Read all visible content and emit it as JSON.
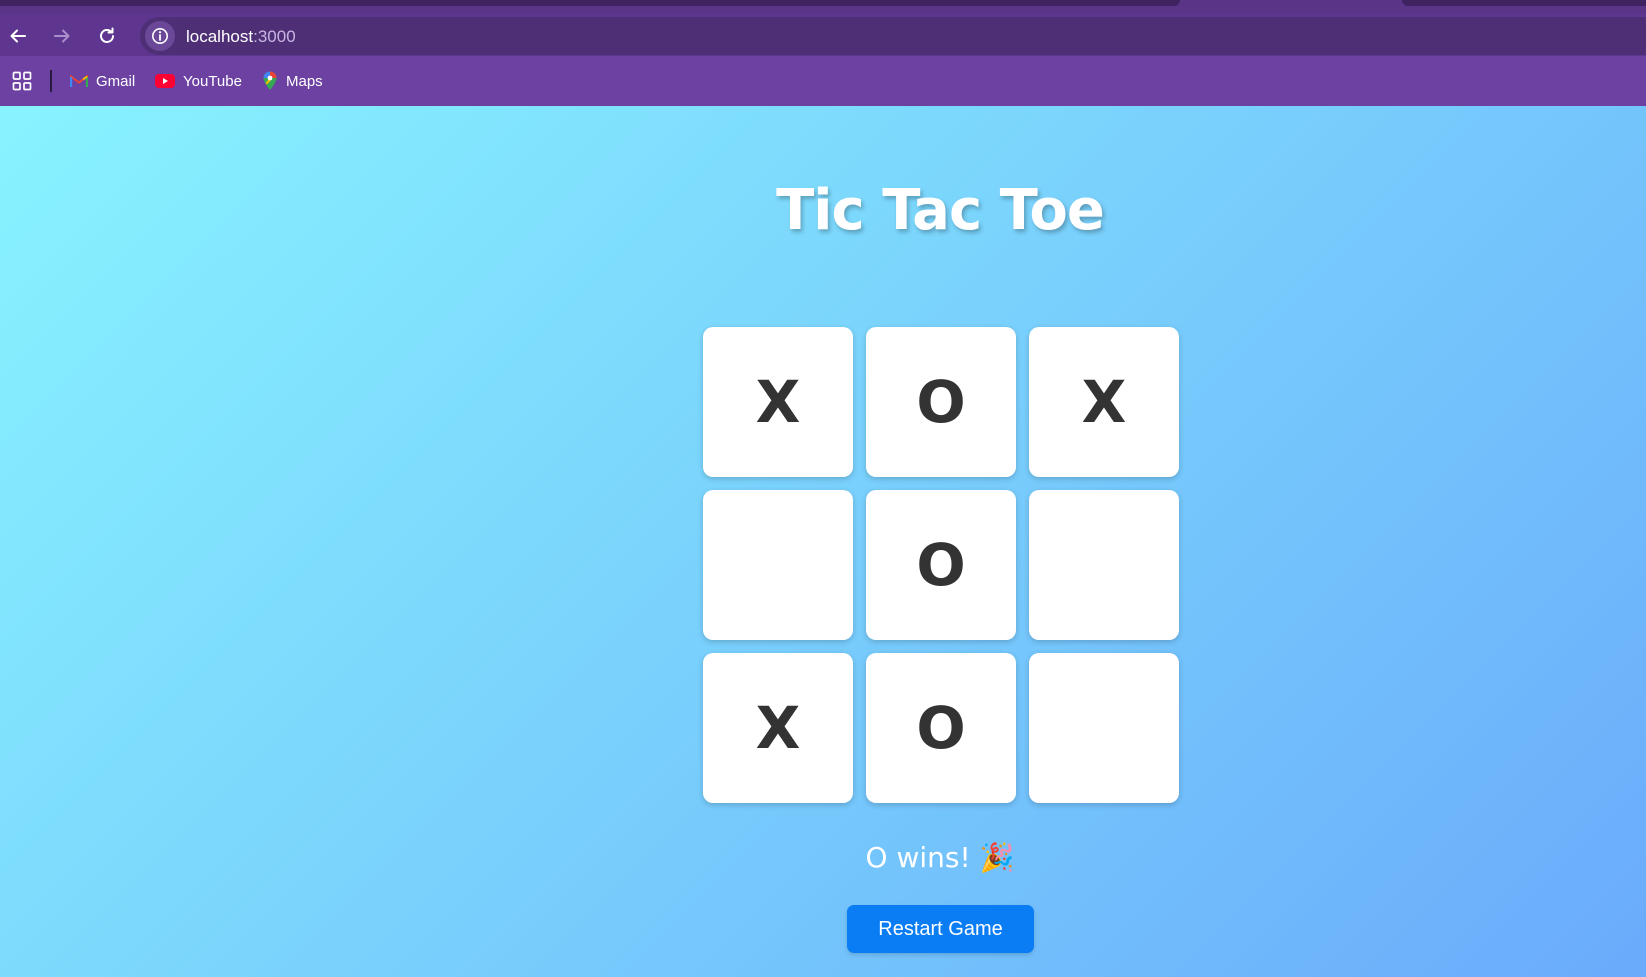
{
  "browser": {
    "url_host": "localhost",
    "url_port": ":3000",
    "bookmarks": [
      {
        "label": "Gmail",
        "icon": "gmail-icon"
      },
      {
        "label": "YouTube",
        "icon": "youtube-icon"
      },
      {
        "label": "Maps",
        "icon": "maps-icon"
      }
    ]
  },
  "game": {
    "title": "Tic Tac Toe",
    "cells": [
      "X",
      "O",
      "X",
      "",
      "O",
      "",
      "X",
      "O",
      ""
    ],
    "status": "O wins! 🎉",
    "restart_label": "Restart Game"
  },
  "colors": {
    "page_gradient": [
      "#88f3ff",
      "#6aabfb"
    ],
    "restart_button": "#0a7df5",
    "chrome": "#5e358f"
  }
}
